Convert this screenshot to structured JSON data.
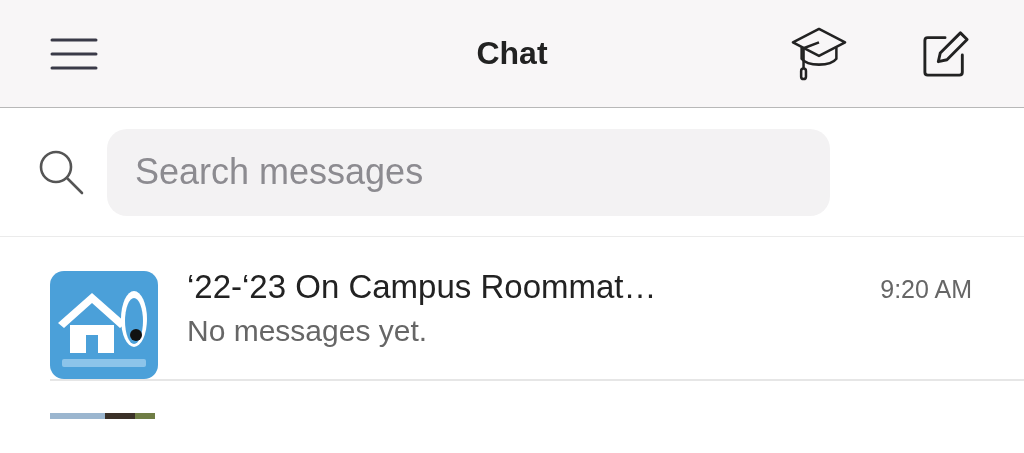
{
  "header": {
    "title": "Chat"
  },
  "search": {
    "placeholder": "Search messages"
  },
  "chats": [
    {
      "kind": "picture",
      "name": "‘22-‘23 On Campus Roommat…",
      "time": "9:20 AM",
      "preview": "No messages yet."
    },
    {
      "kind": "peek"
    }
  ]
}
